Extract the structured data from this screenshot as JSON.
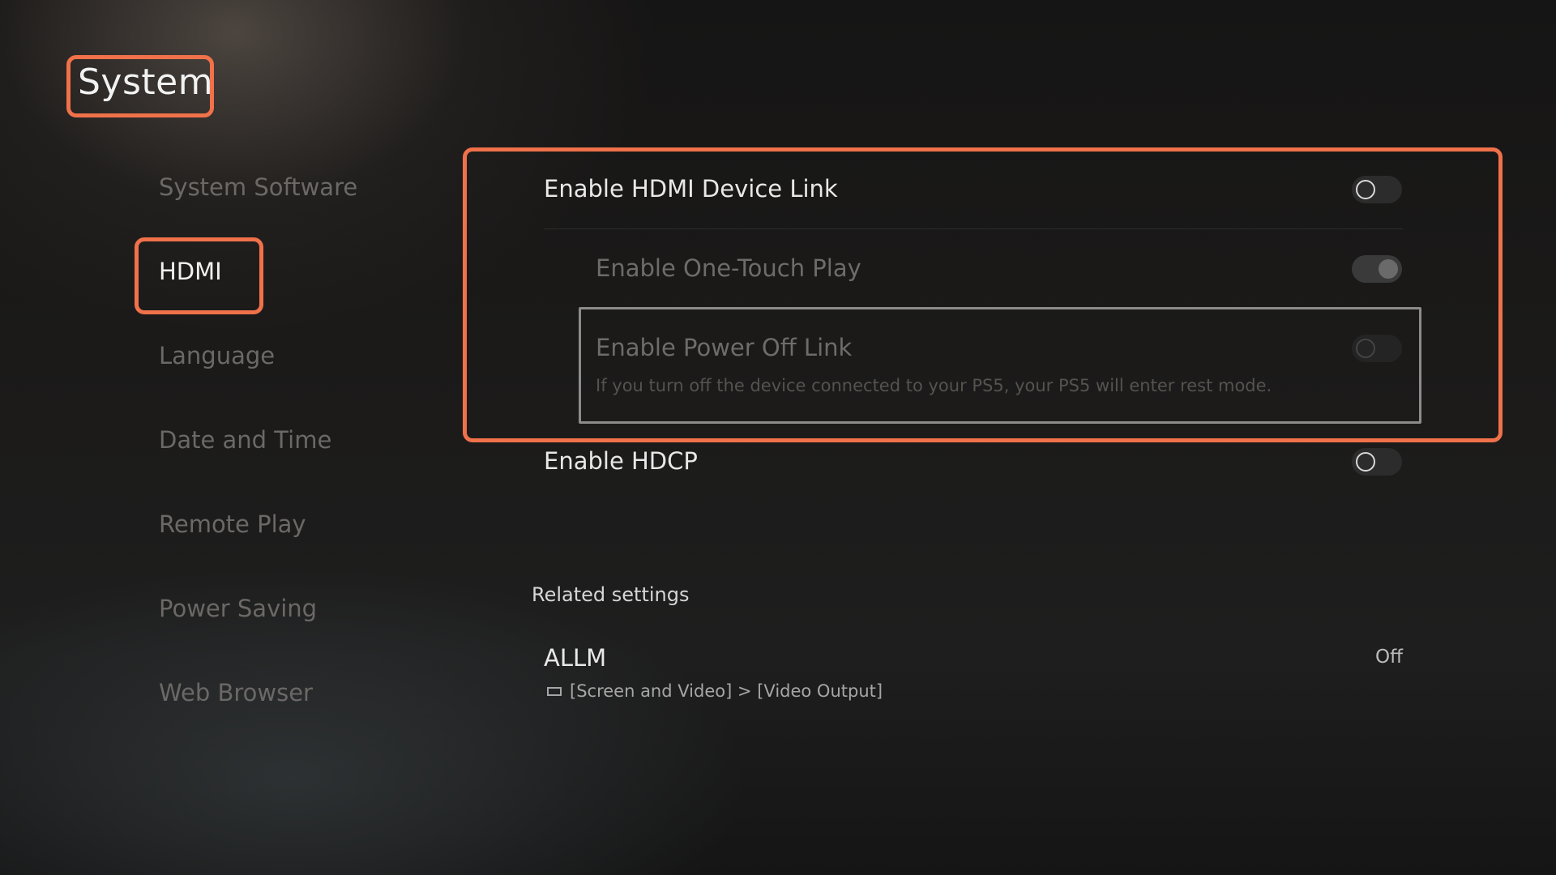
{
  "page": {
    "title": "System"
  },
  "sidebar": {
    "items": [
      {
        "label": "System Software"
      },
      {
        "label": "HDMI"
      },
      {
        "label": "Language"
      },
      {
        "label": "Date and Time"
      },
      {
        "label": "Remote Play"
      },
      {
        "label": "Power Saving"
      },
      {
        "label": "Web Browser"
      }
    ],
    "active": "HDMI"
  },
  "settings": {
    "hdmi_device_link": {
      "label": "Enable HDMI Device Link",
      "enabled": false
    },
    "one_touch_play": {
      "label": "Enable One-Touch Play",
      "enabled": true
    },
    "power_off_link": {
      "label": "Enable Power Off Link",
      "description": "If you turn off the device connected to your PS5, your PS5 will enter rest mode.",
      "enabled": false
    },
    "hdcp": {
      "label": "Enable HDCP",
      "enabled": false
    }
  },
  "related": {
    "title": "Related settings",
    "items": [
      {
        "label": "ALLM",
        "value": "Off",
        "path": "[Screen and Video] > [Video Output]",
        "icon": "screen-icon"
      }
    ]
  },
  "colors": {
    "highlight": "#f0714a"
  }
}
